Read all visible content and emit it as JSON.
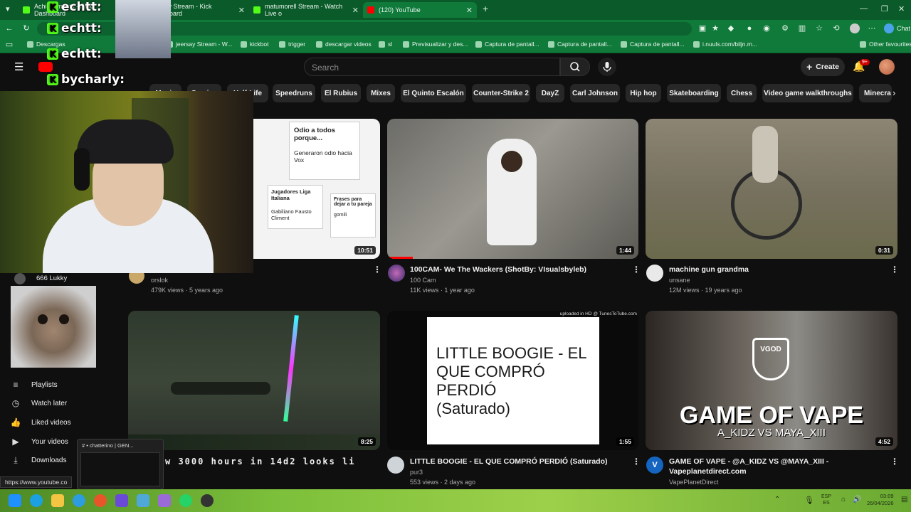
{
  "browser": {
    "tabs": [
      {
        "label": "Achievements - Kick Dashboard",
        "color": "#53fc18"
      },
      {
        "label": "jeersay Stream - Kick Dashboard",
        "color": "#53fc18"
      },
      {
        "label": "matumorell Stream - Watch Live o",
        "color": "#53fc18"
      },
      {
        "label": "(120) YouTube",
        "color": "#ff0000"
      }
    ],
    "new_tab": "+",
    "profile_label": "Chat",
    "bookmarks": [
      "Descargas",
      "jeersay Stream - W...",
      "kickbot",
      "trigger",
      "descargar videos",
      "sl",
      "Previsualizar y des...",
      "Captura de pantall...",
      "Captura de pantall...",
      "Captura de pantall...",
      "i.nuuls.com/biljn.m..."
    ],
    "bookmarks_other": "Other favourites"
  },
  "youtube": {
    "search_placeholder": "Search",
    "create_label": "Create",
    "notif_count": "9+",
    "chips": [
      "Music",
      "Gaming",
      "Half-Life",
      "Speedruns",
      "El Rubius",
      "Mixes",
      "El Quinto Escalón",
      "Counter-Strike 2",
      "DayZ",
      "Carl Johnson",
      "Hip hop",
      "Skateboarding",
      "Chess",
      "Video game walkthroughs",
      "Minecra"
    ],
    "sidebar": {
      "subscription": "666 Lukky",
      "items": [
        {
          "label": "Playlists",
          "icon": "playlist-icon"
        },
        {
          "label": "Watch later",
          "icon": "clock-icon"
        },
        {
          "label": "Liked videos",
          "icon": "thumbs-up-icon"
        },
        {
          "label": "Your videos",
          "icon": "video-icon"
        },
        {
          "label": "Downloads",
          "icon": "download-icon"
        }
      ]
    },
    "videos": [
      {
        "title": "",
        "channel": "orslok",
        "meta": "479K views · 5 years ago",
        "duration": "10:51",
        "thumb_text": {
          "a": "Odio a todos porque...",
          "b": "Generaron odio hacia Vox",
          "c": "Jugadores Liga Italiana",
          "d": "Gabiliano Fausto Climent",
          "e": "Frases para dejar a tu pareja",
          "f": "gomili"
        }
      },
      {
        "title": "100CAM- We The Wackers (ShotBy: VIsualsbyleb)",
        "channel": "100 Cam",
        "meta": "11K views · 1 year ago",
        "duration": "1:44"
      },
      {
        "title": "machine gun grandma",
        "channel": "unsane",
        "meta": "12M views · 19 years ago",
        "duration": "0:31"
      },
      {
        "title": "w 3000 hours in 14d2 looks li",
        "channel": "",
        "meta": "",
        "duration": "8:25"
      },
      {
        "title": "LITTLE BOOGIE - EL QUE COMPRÓ PERDIÓ (Saturado)",
        "channel": "pur3",
        "meta": "553 views · 2 days ago",
        "duration": "1:55",
        "thumb_text": {
          "main": "LITTLE  BOOGIE  - EL QUE COMPRÓ PERDIÓ",
          "sub": "(Saturado)",
          "watermark": "uploaded in HD @ TunesToTube.com"
        }
      },
      {
        "title": "GAME OF VAPE - @A_KIDZ VS @MAYA_XIII - Vapeplanetdirect.com",
        "channel": "VapePlanetDirect",
        "meta": "",
        "duration": "4:52",
        "thumb_text": {
          "main": "GAME OF VAPE",
          "sub": "A_KIDZ VS MAYA_XIII",
          "logo": "VGOD"
        }
      }
    ]
  },
  "overlay": {
    "badges": [
      "echtt:",
      "echtt:",
      "echtt:",
      "bycharly:"
    ],
    "popup_label": "# • chatterino | GEN..."
  },
  "status_url": "https://www.youtube.co",
  "taskbar": {
    "lang_top": "ESP",
    "lang_bottom": "ES",
    "time": "03:09",
    "date": "26/04/2026"
  }
}
